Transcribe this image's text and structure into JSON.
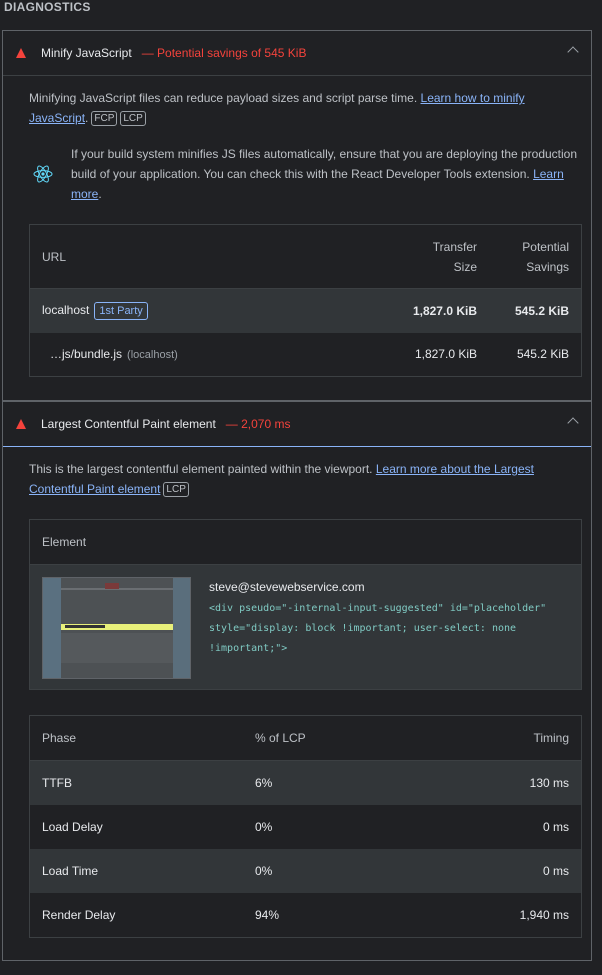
{
  "section_title": "DIAGNOSTICS",
  "audit1": {
    "title": "Minify JavaScript",
    "display": "— Potential savings of 545 KiB",
    "desc_text": "Minifying JavaScript files can reduce payload sizes and script parse time. ",
    "desc_link": "Learn how to minify JavaScript",
    "tags": [
      "FCP",
      "LCP"
    ],
    "stack_text": "If your build system minifies JS files automatically, ensure that you are deploying the production build of your application. You can check this with the React Developer Tools extension. ",
    "stack_link": "Learn more",
    "stack_end": ".",
    "headers": {
      "url": "URL",
      "transfer": "Transfer Size",
      "savings": "Potential Savings"
    },
    "rows": [
      {
        "url": "localhost",
        "badge": "1st Party",
        "transfer": "1,827.0 KiB",
        "savings": "545.2 KiB"
      },
      {
        "url": "…js/bundle.js",
        "sub": "(localhost)",
        "transfer": "1,827.0 KiB",
        "savings": "545.2 KiB"
      }
    ]
  },
  "audit2": {
    "title": "Largest Contentful Paint element",
    "display": "— 2,070 ms",
    "desc_text": "This is the largest contentful element painted within the viewport. ",
    "desc_link": "Learn more about the Largest Contentful Paint element",
    "tag": "LCP",
    "element_header": "Element",
    "element_label": "steve@stevewebservice.com",
    "element_snippet": "<div pseudo=\"-internal-input-suggested\" id=\"placeholder\" style=\"display: block !important; user-select: none !important;\">",
    "phase_headers": {
      "phase": "Phase",
      "pct": "% of LCP",
      "timing": "Timing"
    },
    "phases": [
      {
        "phase": "TTFB",
        "pct": "6%",
        "timing": "130 ms"
      },
      {
        "phase": "Load Delay",
        "pct": "0%",
        "timing": "0 ms"
      },
      {
        "phase": "Load Time",
        "pct": "0%",
        "timing": "0 ms"
      },
      {
        "phase": "Render Delay",
        "pct": "94%",
        "timing": "1,940 ms"
      }
    ]
  },
  "colors": {
    "fail": "#f4433c",
    "link": "#8ab4f8",
    "accent": "#8ab4f8"
  },
  "icons": {
    "fail": "triangle-fail-icon",
    "collapse": "chevron-up-icon",
    "react": "react-icon"
  }
}
